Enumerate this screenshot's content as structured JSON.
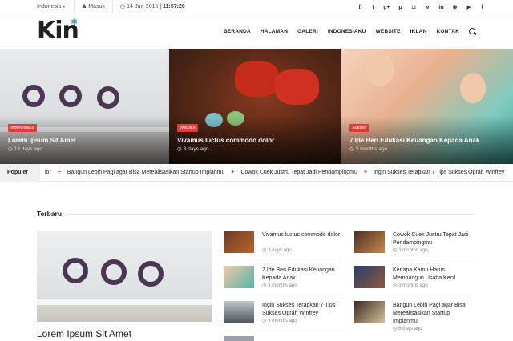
{
  "topbar": {
    "language": "Indonesia",
    "login": "Masuk",
    "date": "14-Jun-2016",
    "time": "11:57:20"
  },
  "social_icons": [
    "facebook-icon",
    "twitter-icon",
    "google-plus-icon",
    "pinterest-icon",
    "instagram-icon",
    "vimeo-icon",
    "linkedin-icon",
    "dribbble-icon",
    "youtube-icon",
    "rss-icon"
  ],
  "social_glyphs": [
    "f",
    "t",
    "g+",
    "p",
    "◘",
    "v",
    "in",
    "⊛",
    "▶",
    "⌇"
  ],
  "header": {
    "logo": "Kin",
    "nav": [
      "BERANDA",
      "HALAMAN",
      "GALERI",
      "INDONESIAKU",
      "WEBSITE",
      "IKLAN",
      "KONTAK"
    ]
  },
  "hero": [
    {
      "category": "Indonesiaku",
      "title": "Lorem Ipsum Sit Amet",
      "time": "13 days ago"
    },
    {
      "category": "Website",
      "title": "Vivamus luctus commodo dolor",
      "time": "3 days ago"
    },
    {
      "category": "Sukses",
      "title": "7 Ide Beri Edukasi Keuangan Kepada Anak",
      "time": "3 months ago"
    }
  ],
  "ticker": {
    "label": "Populer",
    "items": [
      "lor",
      "Bangun Lebih Pagi agar Bisa Merealisasikan Startup Impianmu",
      "Cowok Cuek Justru Tepat Jadi Pendampingmu",
      "Ingin Sukses Terapkan 7 Tips Sukses Oprah Winfrey"
    ]
  },
  "latest": {
    "title": "Terbaru",
    "featured_title": "Lorem Ipsum Sit Amet",
    "col1": [
      {
        "title": "Vivamus luctus commodo dolor",
        "time": "3 days ago"
      },
      {
        "title": "7 Ide Beri Edukasi Keuangan Kepada Anak",
        "time": "3 months ago"
      },
      {
        "title": "Ingin Sukses Terapkan 7 Tips Sukses Oprah Winfrey",
        "time": "3 months ago"
      }
    ],
    "col2": [
      {
        "title": "Cowok Cuek Justru Tepat Jadi Pendampingmu",
        "time": "3 months ago"
      },
      {
        "title": "Kenapa Kamu Harus Membangun Usaha Kecil",
        "time": "3 months ago"
      },
      {
        "title": "Bangun Lebih Pagi agar Bisa Merealisasikan Startup Impianmu",
        "time": "6 days ago"
      }
    ]
  },
  "colors": {
    "accent": "#e23a3a",
    "logo_star": "#4aa3df"
  }
}
